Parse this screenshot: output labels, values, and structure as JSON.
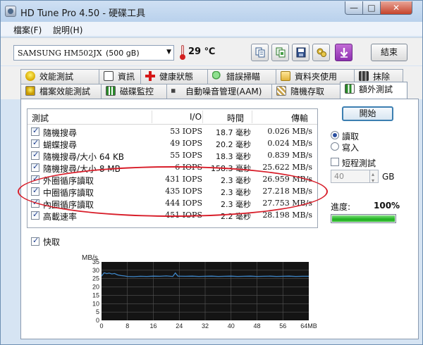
{
  "window": {
    "title": "HD Tune Pro 4.50 - 硬碟工具",
    "min_label": "—",
    "max_label": "□",
    "close_label": "✕"
  },
  "menu": {
    "items": [
      "檔案(F)",
      "說明(H)"
    ]
  },
  "toolbar": {
    "drive": "SAMSUNG HM502JX",
    "drive_size": "(500 gB)",
    "temperature": "29 ℃",
    "exit_label": "結束",
    "icons": [
      "copy-text-icon",
      "copy-screenshot-icon",
      "save-icon",
      "options-icon",
      "download-icon"
    ]
  },
  "tabs": {
    "row1": [
      "效能測試",
      "資訊",
      "健康狀態",
      "錯誤掃瞄",
      "資料夾使用",
      "抹除"
    ],
    "row2": [
      "檔案效能測試",
      "磁碟監控",
      "自動噪音管理(AAM)",
      "隨機存取",
      "額外測試"
    ],
    "active": "額外測試"
  },
  "table": {
    "headers": {
      "test": "測試",
      "io": "I/O",
      "time": "時間",
      "rate": "傳輸"
    },
    "rows": [
      {
        "name": "隨機搜尋",
        "io": "53 IOPS",
        "time": "18.7 毫秒",
        "rate": "0.026 MB/s"
      },
      {
        "name": "蝴蝶搜尋",
        "io": "49 IOPS",
        "time": "20.2 毫秒",
        "rate": "0.024 MB/s"
      },
      {
        "name": "隨機搜尋/大小 64 KB",
        "io": "55 IOPS",
        "time": "18.3 毫秒",
        "rate": "0.839 MB/s"
      },
      {
        "name": "隨機搜尋/大小 8 MB",
        "io": "6 IOPS",
        "time": "158.3 毫秒",
        "rate": "25.622 MB/s"
      },
      {
        "name": "外圈循序讀取",
        "io": "431 IOPS",
        "time": "2.3 毫秒",
        "rate": "26.959 MB/s"
      },
      {
        "name": "中圈循序讀取",
        "io": "435 IOPS",
        "time": "2.3 毫秒",
        "rate": "27.218 MB/s"
      },
      {
        "name": "內圈循序讀取",
        "io": "444 IOPS",
        "time": "2.3 毫秒",
        "rate": "27.753 MB/s"
      },
      {
        "name": "高載速率",
        "io": "451 IOPS",
        "time": "2.2 毫秒",
        "rate": "28.198 MB/s"
      }
    ]
  },
  "controls": {
    "start_label": "開始",
    "read_label": "讀取",
    "write_label": "寫入",
    "mode": "read",
    "short_test_label": "短程測試",
    "short_test_checked": false,
    "size_value": "40",
    "size_unit": "GB",
    "progress_label": "進度:",
    "progress_text": "100%",
    "progress_value": 1.0,
    "cache_label": "快取",
    "cache_checked": true
  },
  "colors": {
    "line": "#3e86c8",
    "progress": "#20b020",
    "highlight": "#d81e2a"
  },
  "chart_data": {
    "type": "line",
    "ylabel": "MB/s",
    "xlabel": "",
    "yticks": [
      0,
      5,
      10,
      15,
      20,
      25,
      30,
      35
    ],
    "xtick_labels": [
      "0",
      "8",
      "16",
      "24",
      "32",
      "40",
      "48",
      "56",
      "64MB"
    ],
    "xlim": [
      0,
      64
    ],
    "ylim": [
      0,
      35
    ],
    "grid": true,
    "series": [
      {
        "values": [
          [
            0,
            26.5
          ],
          [
            0.8,
            28.5
          ],
          [
            1.6,
            28.0
          ],
          [
            2.4,
            28.3
          ],
          [
            3.2,
            27.8
          ],
          [
            4.0,
            28.1
          ],
          [
            5.0,
            27.2
          ],
          [
            6.0,
            26.8
          ],
          [
            7.0,
            26.6
          ],
          [
            8.0,
            26.3
          ],
          [
            10.0,
            26.2
          ],
          [
            12.0,
            26.4
          ],
          [
            14.0,
            26.3
          ],
          [
            16.0,
            26.5
          ],
          [
            18.0,
            26.4
          ],
          [
            20.0,
            26.6
          ],
          [
            22.0,
            26.3
          ],
          [
            22.8,
            28.4
          ],
          [
            23.6,
            26.5
          ],
          [
            26.0,
            26.4
          ],
          [
            28.0,
            26.5
          ],
          [
            30.0,
            26.3
          ],
          [
            32.0,
            26.4
          ],
          [
            34.0,
            26.5
          ],
          [
            36.0,
            26.3
          ],
          [
            38.0,
            26.4
          ],
          [
            40.0,
            26.5
          ],
          [
            42.0,
            26.3
          ],
          [
            44.0,
            26.4
          ],
          [
            46.0,
            26.5
          ],
          [
            48.0,
            26.3
          ],
          [
            50.0,
            26.4
          ],
          [
            52.0,
            26.5
          ],
          [
            54.0,
            26.3
          ],
          [
            56.0,
            26.4
          ],
          [
            58.0,
            26.5
          ],
          [
            60.0,
            26.3
          ],
          [
            62.0,
            26.4
          ],
          [
            64.0,
            26.4
          ]
        ]
      }
    ]
  }
}
